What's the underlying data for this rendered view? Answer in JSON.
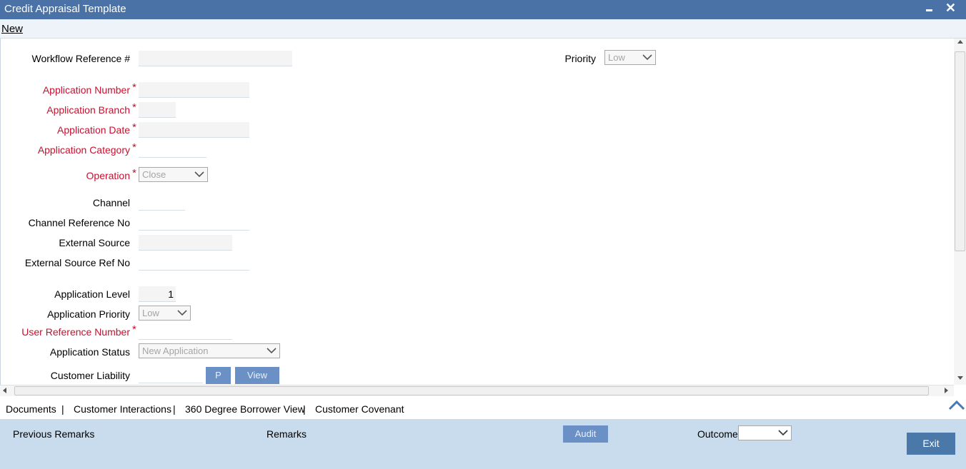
{
  "window": {
    "title": "Credit Appraisal Template"
  },
  "menu": {
    "new": "New"
  },
  "form": {
    "workflow_ref_label": "Workflow Reference #",
    "priority_label": "Priority",
    "priority_value": "Low",
    "app_number_label": "Application Number",
    "app_branch_label": "Application Branch",
    "app_date_label": "Application Date",
    "app_category_label": "Application Category",
    "operation_label": "Operation",
    "operation_value": "Close",
    "channel_label": "Channel",
    "channel_ref_label": "Channel Reference No",
    "ext_source_label": "External Source",
    "ext_source_ref_label": "External Source Ref No",
    "app_level_label": "Application Level",
    "app_level_value": "1",
    "app_priority_label": "Application Priority",
    "app_priority_value": "Low",
    "user_ref_label": "User Reference Number",
    "app_status_label": "Application Status",
    "app_status_value": "New Application",
    "cust_liability_label": "Customer Liability",
    "p_button": "P",
    "view_button": "View",
    "required_mark": "*"
  },
  "tabs": {
    "documents": "Documents",
    "customer_interactions": "Customer Interactions",
    "borrower_view": "360 Degree Borrower View",
    "customer_covenant": "Customer Covenant",
    "separator": "|"
  },
  "footer": {
    "previous_remarks": "Previous Remarks",
    "remarks": "Remarks",
    "audit": "Audit",
    "outcome_label": "Outcome",
    "outcome_value": "",
    "exit": "Exit"
  },
  "colors": {
    "titlebar": "#4a72a6",
    "required": "#c8102e",
    "button": "#6a90c6",
    "footer": "#c8dced",
    "exit_button": "#4a78a8"
  },
  "icons": {
    "minimize": "minimize-icon",
    "close": "close-icon",
    "dropdown": "chevron-down-icon",
    "collapse": "chevron-up-icon"
  }
}
